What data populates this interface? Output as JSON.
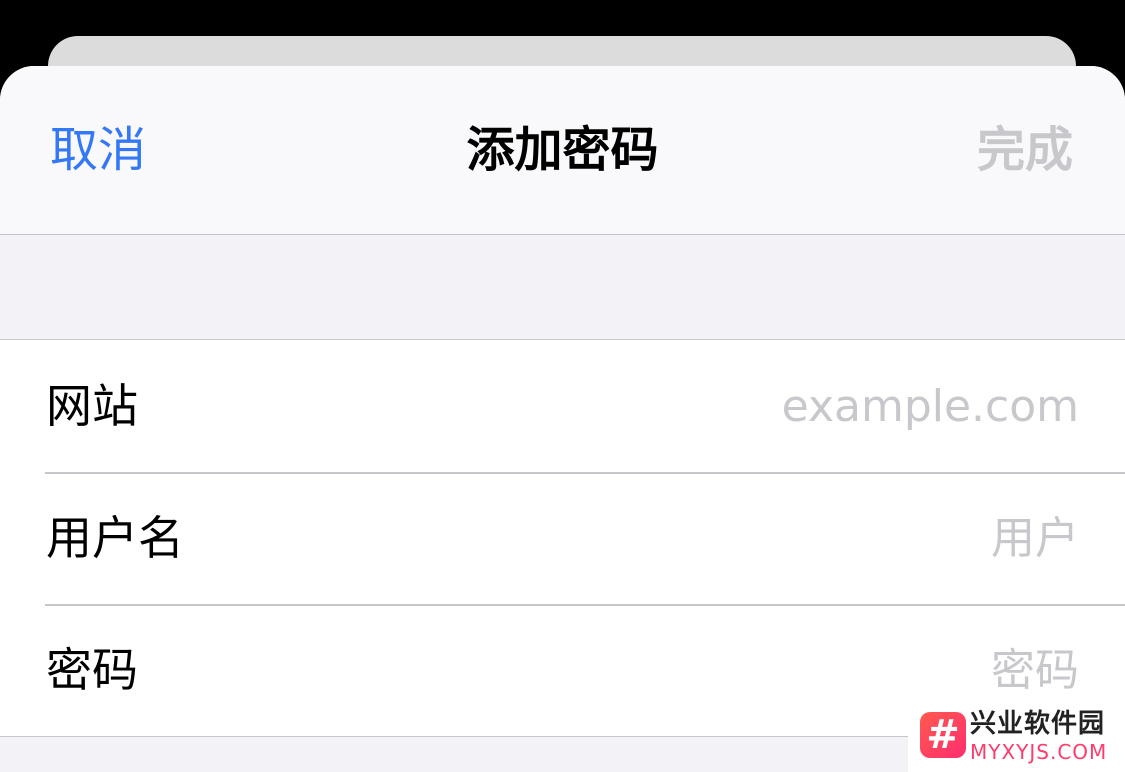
{
  "nav": {
    "cancel": "取消",
    "title": "添加密码",
    "done": "完成"
  },
  "form": {
    "rows": [
      {
        "label": "网站",
        "placeholder": "example.com",
        "value": ""
      },
      {
        "label": "用户名",
        "placeholder": "用户",
        "value": ""
      },
      {
        "label": "密码",
        "placeholder": "密码",
        "value": ""
      }
    ]
  },
  "watermark": {
    "logo_glyph": "#",
    "name": "兴业软件园",
    "domain": "MYXYJS.COM"
  },
  "colors": {
    "accent": "#3478f6",
    "disabled": "#c7c7cc",
    "background": "#f2f2f7"
  }
}
